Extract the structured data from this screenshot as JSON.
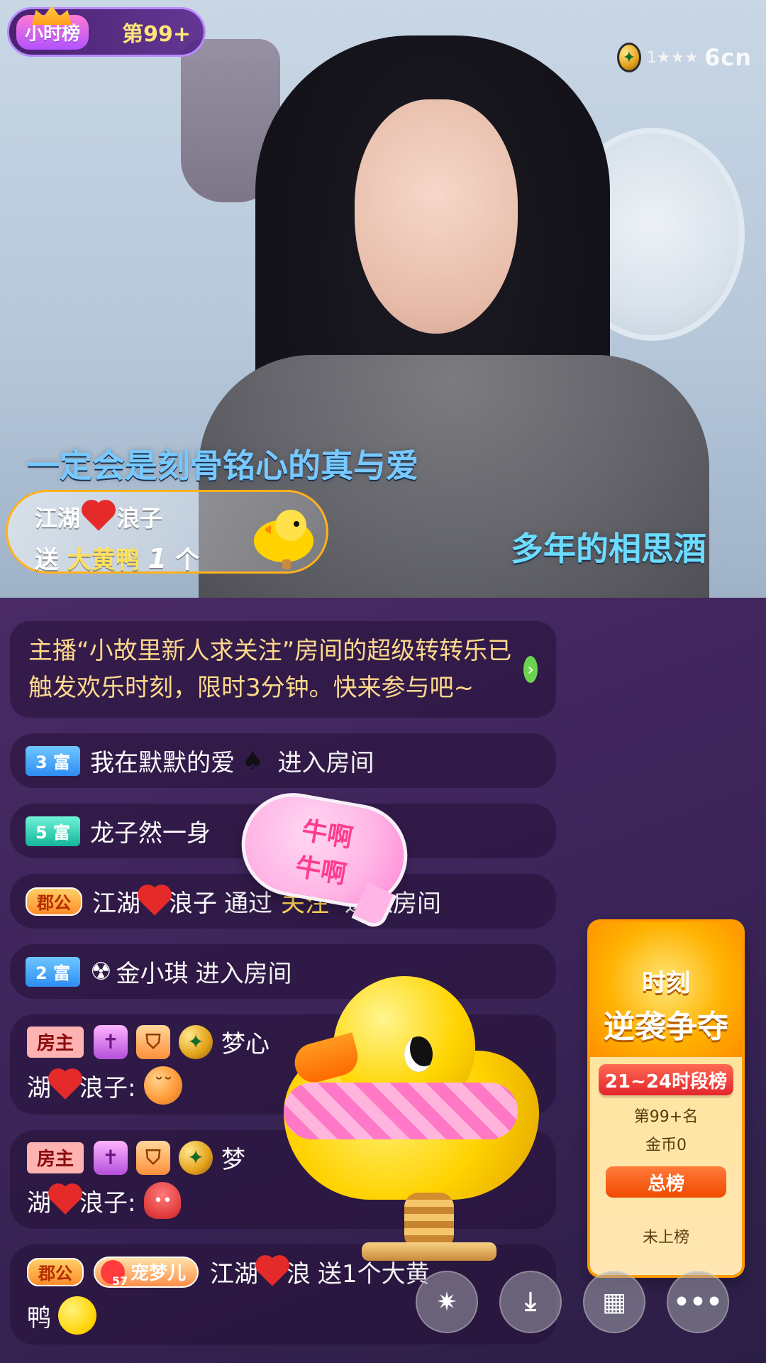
{
  "hour_rank": {
    "label": "小时榜",
    "value": "第99+"
  },
  "top_right": {
    "stars": "1★★★",
    "logo": "6cn"
  },
  "lyrics": {
    "line1": "一定会是刻骨铭心的真与爱",
    "line2": "多年的相思酒"
  },
  "gift_banner": {
    "user_left": "江湖",
    "user_right": "浪子",
    "send_prefix": "送",
    "gift_name": "大黄鸭",
    "count": "1",
    "unit": "个"
  },
  "chat": {
    "system": {
      "text": "主播“小故里新人求关注”房间的超级转转乐已触发欢乐时刻，限时3分钟。快来参与吧~",
      "go_icon": "chevron-right-icon"
    },
    "items": [
      {
        "level": "3 富",
        "name": "我在默默的爱",
        "suffix": "♠",
        "action": "进入房间"
      },
      {
        "level": "5 富",
        "name": "龙子然一身",
        "action": ""
      },
      {
        "level": "郡公",
        "name_left": "江湖",
        "name_right": "浪子",
        "via": "通过",
        "follow": "关注",
        "action": "进入房间"
      },
      {
        "level": "2 富",
        "prefix": "☢",
        "name": "金小琪",
        "action": "进入房间"
      }
    ],
    "owner_msg_1": {
      "owner": "房主",
      "name": "梦心",
      "line2_left": "湖",
      "line2_right": "浪子:",
      "emoji": "😌"
    },
    "owner_msg_2": {
      "owner": "房主",
      "name": "梦",
      "line2_left": "湖",
      "line2_right": "浪子:",
      "emoji": "👾"
    },
    "last_msg": {
      "level": "郡公",
      "pet_badge": "宠梦儿",
      "pet_num": "57",
      "user_left": "江湖",
      "user_right": "浪",
      "text_tail": "送1个大黄",
      "line2": "鸭"
    }
  },
  "sticker": {
    "line1": "牛啊",
    "line2": "牛啊"
  },
  "event_panel": {
    "title_1": "时刻",
    "title_2": "逆袭争夺",
    "period": "21~24时段榜",
    "rank": "第99+名",
    "coins": "金币0",
    "button": "总榜",
    "status": "未上榜"
  },
  "bottom_controls": {
    "btn1_icon": "sparkle-icon",
    "btn2_icon": "download-icon",
    "btn3_icon": "grid-icon",
    "btn4_icon": "more-icon",
    "btn1_symbol": "✷",
    "btn2_symbol": "⤓",
    "btn3_symbol": "▦",
    "btn4_symbol": "•••"
  }
}
